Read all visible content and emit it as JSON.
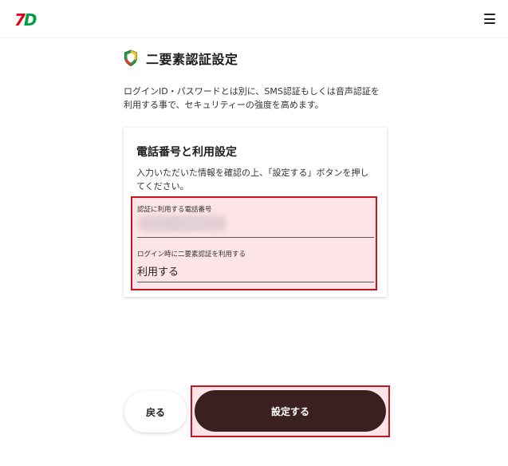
{
  "header": {
    "logo_seven": "7",
    "logo_d": "D",
    "menu_icon": "hamburger-menu-icon"
  },
  "page": {
    "title": "二要素認証設定",
    "title_icon": "security-shield-icon",
    "description": "ログインID・パスワードとは別に、SMS認証もしくは音声認証を利用する事で、セキュリティーの強度を高めます。"
  },
  "card": {
    "title": "電話番号と利用設定",
    "description": "入力いただいた情報を確認の上、「設定する」ボタンを押してください。",
    "fields": [
      {
        "label": "認証に利用する電話番号",
        "value": ""
      },
      {
        "label": "ログイン時に二要素認証を利用する",
        "value": "利用する"
      }
    ]
  },
  "buttons": {
    "back_label": "戻る",
    "submit_label": "設定する"
  },
  "colors": {
    "logo_red": "#e60012",
    "logo_green": "#00a040",
    "submit_bg": "#3b2020",
    "highlight_border": "#c8141e",
    "highlight_fill": "#fde4e6"
  }
}
